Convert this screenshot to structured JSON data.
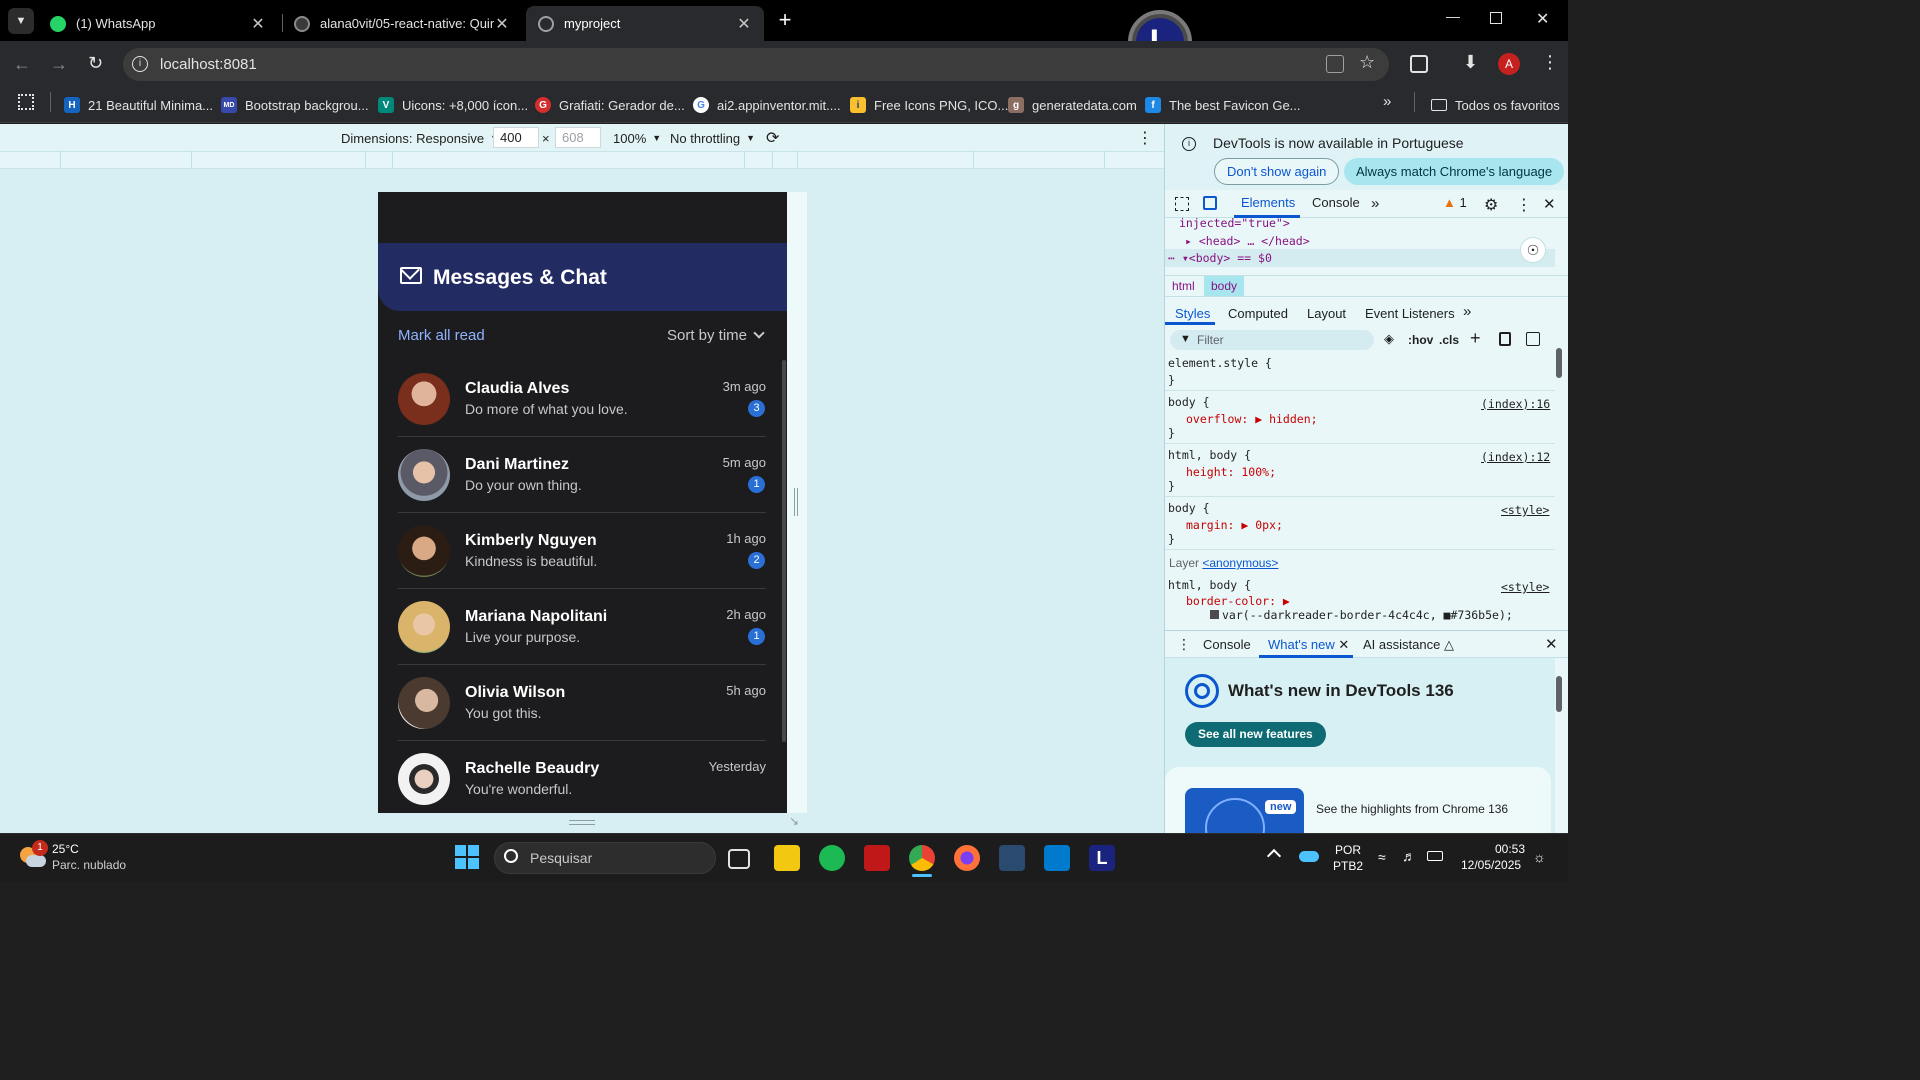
{
  "tabs": [
    {
      "title": "(1) WhatsApp"
    },
    {
      "title": "alana0vit/05-react-native: Quint"
    },
    {
      "title": "myproject"
    }
  ],
  "address": "localhost:8081",
  "bookmarks": [
    "21 Beautiful Minima...",
    "Bootstrap backgrou...",
    "Uicons: +8,000 ícon...",
    "Grafiati: Gerador de...",
    "ai2.appinventor.mit....",
    "Free Icons PNG, ICO...",
    "generatedata.com",
    "The best Favicon Ge..."
  ],
  "all_bookmarks": "Todos os favoritos",
  "device_toolbar": {
    "dimensions": "Dimensions: Responsive",
    "width": "400",
    "times": "×",
    "height": "608",
    "zoom": "100%",
    "throttling": "No throttling"
  },
  "app": {
    "title": "Messages & Chat",
    "mark_all": "Mark all read",
    "sort": "Sort by time",
    "chats": [
      {
        "name": "Claudia Alves",
        "message": "Do more of what you love.",
        "time": "3m ago",
        "unread": "3"
      },
      {
        "name": "Dani Martinez",
        "message": "Do your own thing.",
        "time": "5m ago",
        "unread": "1"
      },
      {
        "name": "Kimberly Nguyen",
        "message": "Kindness is beautiful.",
        "time": "1h ago",
        "unread": "2"
      },
      {
        "name": "Mariana Napolitani",
        "message": "Live your purpose.",
        "time": "2h ago",
        "unread": "1"
      },
      {
        "name": "Olivia Wilson",
        "message": "You got this.",
        "time": "5h ago",
        "unread": ""
      },
      {
        "name": "Rachelle Beaudry",
        "message": "You're wonderful.",
        "time": "Yesterday",
        "unread": ""
      }
    ]
  },
  "devtools": {
    "info": "DevTools is now available in Portuguese",
    "dont_show": "Don't show again",
    "always_match": "Always match Chrome's language",
    "tabs": {
      "elements": "Elements",
      "console": "Console"
    },
    "issues": "1",
    "dom_lines": [
      "injected=\"true\">",
      "<head> … </head>",
      "<body> == $0"
    ],
    "crumbs": [
      "html",
      "body"
    ],
    "style_tabs": [
      "Styles",
      "Computed",
      "Layout",
      "Event Listeners"
    ],
    "filter": "Filter",
    "hov": ":hov",
    "cls": ".cls",
    "rules": [
      {
        "selector": "element.style {",
        "decl": "",
        "source": ""
      },
      {
        "selector": "body {",
        "decl": "overflow: ▶ hidden;",
        "source": "(index):16"
      },
      {
        "selector": "html, body {",
        "decl": "height: 100%;",
        "source": "(index):12"
      },
      {
        "selector": "body {",
        "decl": "margin: ▶ 0px;",
        "source": "<style>"
      }
    ],
    "layer_label": "Layer",
    "layer_link": "<anonymous>",
    "last_rule_selector": "html, body {",
    "last_rule_source": "<style>",
    "last_rule_decl": "border-color: ▶",
    "last_rule_value": "var(--darkreader-border-4c4c4c, ■#736b5e);",
    "drawer_tabs": [
      "Console",
      "What's new",
      "AI assistance"
    ],
    "whats_new_title": "What's new in DevTools 136",
    "see_all": "See all new features",
    "new_badge": "new",
    "highlights": "See the highlights from Chrome 136"
  },
  "taskbar": {
    "temp": "25°C",
    "weather": "Parc. nublado",
    "weather_badge": "1",
    "search": "Pesquisar",
    "lang1": "POR",
    "lang2": "PTB2",
    "time": "00:53",
    "date": "12/05/2025"
  },
  "colors": {
    "accent": "#232b63",
    "badge": "#2a6fd6",
    "devtools_bg": "#e9f7f9"
  }
}
